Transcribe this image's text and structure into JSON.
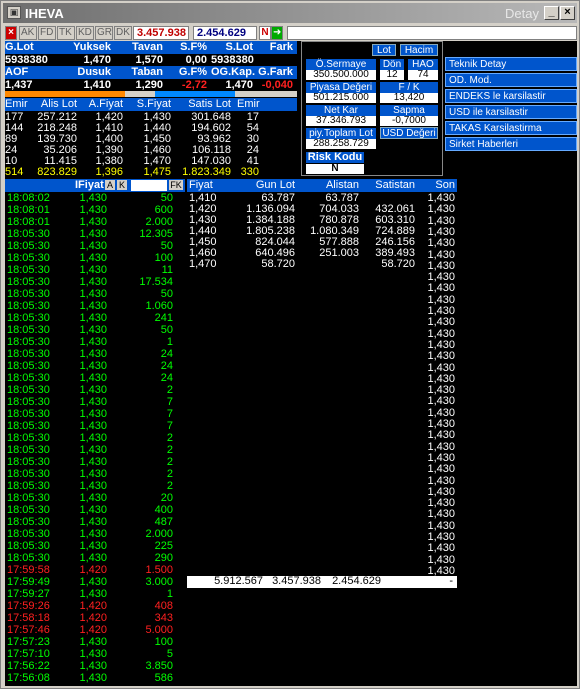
{
  "window": {
    "title": "IHEVA",
    "detay": "Detay"
  },
  "toolbar": {
    "tabs": [
      "AK",
      "FD",
      "TK",
      "KD",
      "GR",
      "DK"
    ],
    "value1": "3.457.938",
    "value2": "2.454.629",
    "n": "N"
  },
  "summary": {
    "h1": [
      "G.Lot",
      "Yuksek",
      "Tavan",
      "S.F%",
      "S.Lot",
      "Fark"
    ],
    "r1": [
      "5938380",
      "1,470",
      "1,570",
      "0,00",
      "5938380",
      ""
    ],
    "h2": [
      "AOF",
      "Dusuk",
      "Taban",
      "G.F%",
      "OG.Kap.",
      "G.Fark"
    ],
    "r2": [
      "1,437",
      "1,410",
      "1,290",
      "-2,72",
      "1,470",
      "-0,040"
    ]
  },
  "depth": {
    "headers": [
      "Emir",
      "Alis Lot",
      "A.Fiyat",
      "S.Fiyat",
      "Satis Lot",
      "Emir"
    ],
    "rows": [
      [
        "177",
        "257.212",
        "1,420",
        "1,430",
        "301.648",
        "17"
      ],
      [
        "144",
        "218.248",
        "1,410",
        "1,440",
        "194.602",
        "54"
      ],
      [
        "89",
        "139.730",
        "1,400",
        "1,450",
        "93.962",
        "30"
      ],
      [
        "24",
        "35.206",
        "1,390",
        "1,460",
        "106.118",
        "24"
      ],
      [
        "10",
        "11.415",
        "1,380",
        "1,470",
        "147.030",
        "41"
      ]
    ],
    "total": [
      "514",
      "823.829",
      "1,396",
      "1,475",
      "1.823.349",
      "330"
    ]
  },
  "info": {
    "lot": "Lot",
    "hacim": "Hacim",
    "osermaye": "Ö.Sermaye",
    "osermaye_v": "350.500.000",
    "don": "Dön",
    "don_v": "12",
    "hao": "HAO",
    "hao_v": "74",
    "piyasa": "Piyasa Değeri",
    "piyasa_v": "501.215.000",
    "fk": "F / K",
    "fk_v": "13,420",
    "netkar": "Net Kar",
    "netkar_v": "37.346.793",
    "sapma": "Sapma",
    "sapma_v": "-0,7000",
    "toplam": "piy.Toplam Lot",
    "toplam_v": "288.258.729",
    "usd": "USD Değeri",
    "risk": "Risk Kodu",
    "risk_v": "N"
  },
  "side": [
    "Teknik Detay",
    "OD. Mod.",
    "ENDEKS le karsilastir",
    "USD ile karsilastir",
    "TAKAS Karsilastirma",
    "Sirket Haberleri"
  ],
  "trades_header": {
    "fiyat": "IFiyat",
    "a": "A",
    "k": "K",
    "fk": "FK"
  },
  "trades": [
    [
      "18:08:02",
      "1,430",
      "50",
      "g"
    ],
    [
      "18:08:01",
      "1,430",
      "600",
      "g"
    ],
    [
      "18:08:01",
      "1,430",
      "2.000",
      "g"
    ],
    [
      "18:05:30",
      "1,430",
      "12.305",
      "g"
    ],
    [
      "18:05:30",
      "1,430",
      "50",
      "g"
    ],
    [
      "18:05:30",
      "1,430",
      "100",
      "g"
    ],
    [
      "18:05:30",
      "1,430",
      "11",
      "g"
    ],
    [
      "18:05:30",
      "1,430",
      "17.534",
      "g"
    ],
    [
      "18:05:30",
      "1,430",
      "50",
      "g"
    ],
    [
      "18:05:30",
      "1,430",
      "1.060",
      "g"
    ],
    [
      "18:05:30",
      "1,430",
      "241",
      "g"
    ],
    [
      "18:05:30",
      "1,430",
      "50",
      "g"
    ],
    [
      "18:05:30",
      "1,430",
      "1",
      "g"
    ],
    [
      "18:05:30",
      "1,430",
      "24",
      "g"
    ],
    [
      "18:05:30",
      "1,430",
      "24",
      "g"
    ],
    [
      "18:05:30",
      "1,430",
      "24",
      "g"
    ],
    [
      "18:05:30",
      "1,430",
      "2",
      "g"
    ],
    [
      "18:05:30",
      "1,430",
      "7",
      "g"
    ],
    [
      "18:05:30",
      "1,430",
      "7",
      "g"
    ],
    [
      "18:05:30",
      "1,430",
      "7",
      "g"
    ],
    [
      "18:05:30",
      "1,430",
      "2",
      "g"
    ],
    [
      "18:05:30",
      "1,430",
      "2",
      "g"
    ],
    [
      "18:05:30",
      "1,430",
      "2",
      "g"
    ],
    [
      "18:05:30",
      "1,430",
      "2",
      "g"
    ],
    [
      "18:05:30",
      "1,430",
      "2",
      "g"
    ],
    [
      "18:05:30",
      "1,430",
      "20",
      "g"
    ],
    [
      "18:05:30",
      "1,430",
      "400",
      "g"
    ],
    [
      "18:05:30",
      "1,430",
      "487",
      "g"
    ],
    [
      "18:05:30",
      "1,430",
      "2.000",
      "g"
    ],
    [
      "18:05:30",
      "1,430",
      "225",
      "g"
    ],
    [
      "18:05:30",
      "1,430",
      "290",
      "g"
    ],
    [
      "17:59:58",
      "1,420",
      "1.500",
      "r"
    ],
    [
      "17:59:49",
      "1,430",
      "3.000",
      "g"
    ],
    [
      "17:59:27",
      "1,430",
      "1",
      "g"
    ],
    [
      "17:59:26",
      "1,420",
      "408",
      "r"
    ],
    [
      "17:58:18",
      "1,420",
      "343",
      "r"
    ],
    [
      "17:57:46",
      "1,420",
      "5.000",
      "r"
    ],
    [
      "17:57:23",
      "1,430",
      "100",
      "g"
    ],
    [
      "17:57:10",
      "1,430",
      "5",
      "g"
    ],
    [
      "17:56:22",
      "1,430",
      "3.850",
      "g"
    ],
    [
      "17:56:08",
      "1,430",
      "586",
      "g"
    ]
  ],
  "book_headers": [
    "Fiyat",
    "Gun Lot",
    "Alistan",
    "Satistan",
    "Son"
  ],
  "book": [
    [
      "1,410",
      "63.787",
      "63.787",
      ""
    ],
    [
      "1,420",
      "1.136.094",
      "704.033",
      "432.061"
    ],
    [
      "1,430",
      "1.384.188",
      "780.878",
      "603.310"
    ],
    [
      "1,440",
      "1.805.238",
      "1.080.349",
      "724.889"
    ],
    [
      "1,450",
      "824.044",
      "577.888",
      "246.156"
    ],
    [
      "1,460",
      "640.496",
      "251.003",
      "389.493"
    ],
    [
      "1,470",
      "58.720",
      "",
      "58.720"
    ]
  ],
  "son_value": "1,430",
  "book_total": [
    "5.912.567",
    "3.457.938",
    "2.454.629",
    "-"
  ]
}
